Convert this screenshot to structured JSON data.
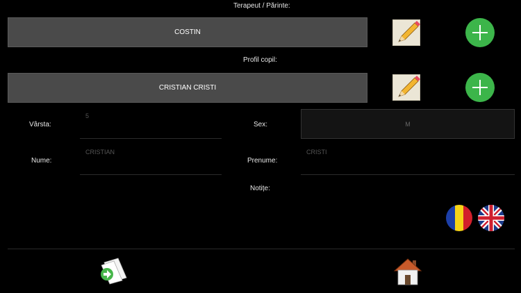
{
  "therapist": {
    "label": "Terapeut / Părinte:",
    "value": "COSTIN"
  },
  "child_profile": {
    "label": "Profil copil:",
    "value": "CRISTIAN CRISTI"
  },
  "form": {
    "age_label": "Vârsta:",
    "age_value": "5",
    "sex_label": "Sex:",
    "sex_value": "M",
    "name_label": "Nume:",
    "name_value": "CRISTIAN",
    "surname_label": "Prenume:",
    "surname_value": "CRISTI",
    "notes_label": "Notițe:"
  },
  "icons": {
    "edit": "pencil-icon",
    "add": "plus-icon",
    "lang_ro": "romania-flag-icon",
    "lang_en": "uk-flag-icon",
    "export": "document-export-icon",
    "home": "home-icon"
  },
  "colors": {
    "background": "#000000",
    "bar": "#4a4a4a",
    "accent_green": "#3cb54a",
    "edit_bg": "#ebe6d6"
  }
}
